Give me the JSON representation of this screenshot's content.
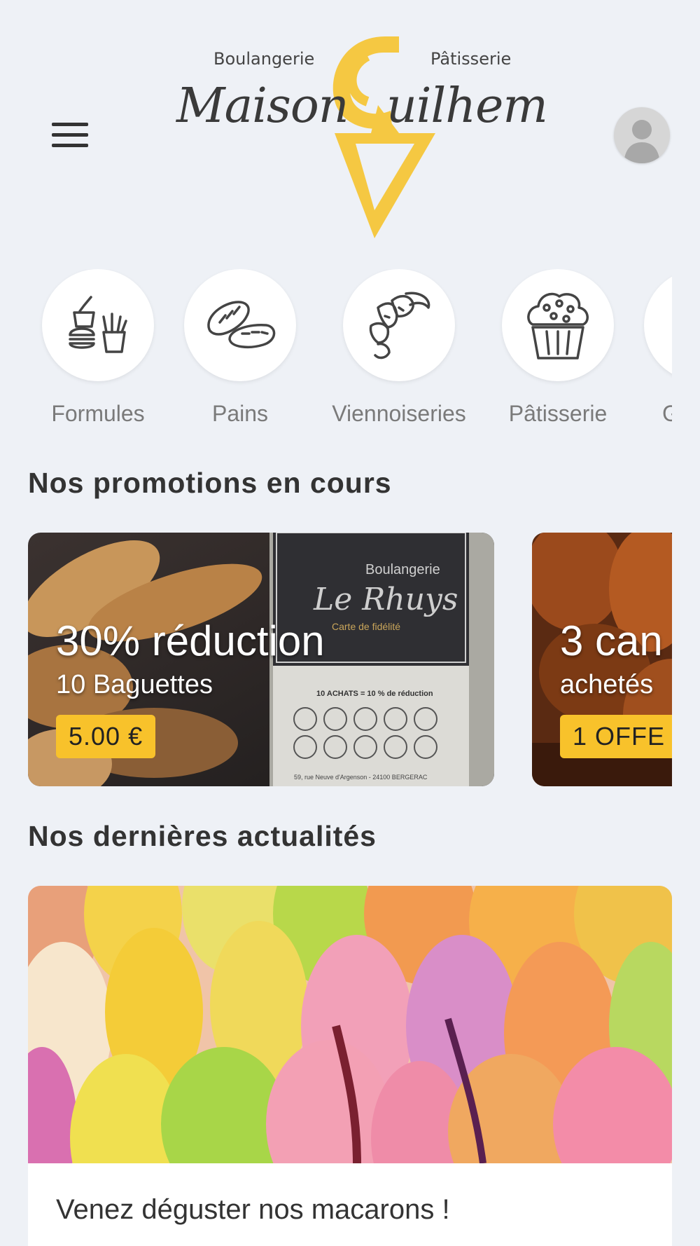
{
  "header": {
    "logo_top_left": "Boulangerie",
    "logo_top_right": "Pâtisserie",
    "logo_name_left": "Maison",
    "logo_name_right": "uilhem",
    "accent_color": "#f5c842"
  },
  "categories": [
    {
      "label": "Formules",
      "icon": "burger-fries-icon"
    },
    {
      "label": "Pains",
      "icon": "bread-icon"
    },
    {
      "label": "Viennoiseries",
      "icon": "croissant-icon"
    },
    {
      "label": "Pâtisserie",
      "icon": "muffin-icon"
    },
    {
      "label": "G",
      "icon": "partial-category-icon"
    }
  ],
  "promotions": {
    "title": "Nos promotions en cours",
    "items": [
      {
        "title": "30% réduction",
        "subtitle": "10 Baguettes",
        "badge": "5.00 €",
        "card_brand": "Boulangerie",
        "card_name": "Le Rhuys",
        "card_caption": "Carte de fidélité",
        "card_rule": "10 ACHATS = 10 % de réduction",
        "card_address": "59, rue Neuve d'Argenson - 24100 BERGERAC"
      },
      {
        "title": "3 can",
        "subtitle": "achetés",
        "badge": "1 OFFE"
      }
    ]
  },
  "news": {
    "title": "Nos dernières actualités",
    "items": [
      {
        "title": "Venez déguster nos macarons !"
      }
    ]
  }
}
